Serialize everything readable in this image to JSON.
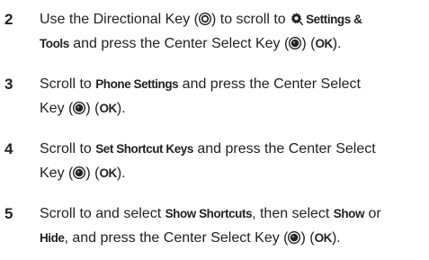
{
  "steps": [
    {
      "number": "2",
      "line1": {
        "t1": "Use the Directional Key (",
        "t2": ") to scroll to ",
        "menu1": "Settings &"
      },
      "line2": {
        "menu1": "Tools",
        "t1": " and press the Center Select Key (",
        "t2": ") (",
        "menu2": "OK",
        "t3": ")."
      }
    },
    {
      "number": "3",
      "line1": {
        "t1": "Scroll to ",
        "menu1": "Phone Settings",
        "t2": " and press the Center Select"
      },
      "line2": {
        "t1": "Key (",
        "t2": ") (",
        "menu1": "OK",
        "t3": ")."
      }
    },
    {
      "number": "4",
      "line1": {
        "t1": "Scroll to ",
        "menu1": "Set Shortcut Keys",
        "t2": " and press the Center Select"
      },
      "line2": {
        "t1": "Key (",
        "t2": ") (",
        "menu1": "OK",
        "t3": ")."
      }
    },
    {
      "number": "5",
      "line1": {
        "t1": "Scroll to and select ",
        "menu1": "Show Shortcuts",
        "t2": ", then select ",
        "menu2": "Show",
        "t3": " or"
      },
      "line2": {
        "menu1": "Hide",
        "t1": ", and press the Center Select Key (",
        "t2": ") (",
        "menu2": "OK",
        "t3": ")."
      }
    }
  ],
  "icons": {
    "directional_key": "directional-key-icon",
    "center_select_key": "center-select-key-icon",
    "settings": "settings-tools-icon"
  }
}
